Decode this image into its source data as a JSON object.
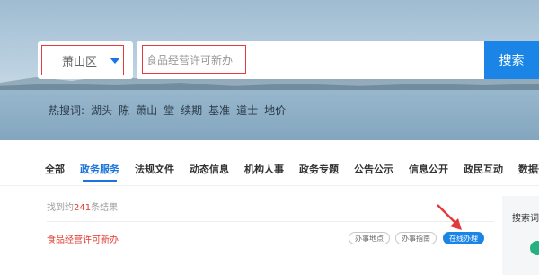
{
  "search": {
    "region": "萧山区",
    "query": "食品经营许可新办",
    "button_label": "搜索"
  },
  "hot_searches": {
    "label": "热搜词:",
    "terms": [
      "湖头",
      "陈",
      "萧山",
      "堂",
      "续期",
      "基准",
      "道士",
      "地价"
    ]
  },
  "tabs": [
    {
      "label": "全部",
      "active": false
    },
    {
      "label": "政务服务",
      "active": true
    },
    {
      "label": "法规文件",
      "active": false
    },
    {
      "label": "动态信息",
      "active": false
    },
    {
      "label": "机构人事",
      "active": false
    },
    {
      "label": "政务专题",
      "active": false
    },
    {
      "label": "公告公示",
      "active": false
    },
    {
      "label": "信息公开",
      "active": false
    },
    {
      "label": "政民互动",
      "active": false
    },
    {
      "label": "数据开",
      "active": false
    }
  ],
  "results": {
    "count_prefix": "找到约",
    "count": "241",
    "count_suffix": "条结果",
    "items": [
      {
        "title": "食品经营许可新办",
        "actions": [
          "办事地点",
          "办事指南",
          "在线办理"
        ]
      }
    ]
  },
  "sidebar": {
    "title": "搜索词"
  },
  "colors": {
    "accent": "#1b84e7",
    "highlight": "#e23b3b"
  }
}
